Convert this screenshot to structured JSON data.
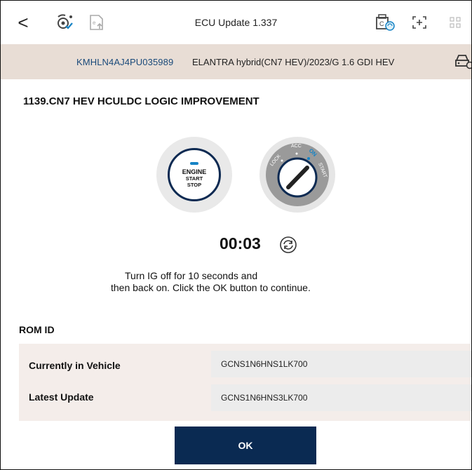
{
  "toolbar": {
    "title": "ECU Update 1.337",
    "back_glyph": "<",
    "icons": [
      "back-icon",
      "wireless-diagnosis-icon",
      "ecu-upload-icon",
      "vci-connection-icon",
      "screen-capture-icon",
      "grid-menu-icon"
    ]
  },
  "vehicle": {
    "vin": "KMHLN4AJ4PU035989",
    "description": "ELANTRA hybrid(CN7 HEV)/2023/G 1.6 GDI HEV"
  },
  "update": {
    "heading": "1139.CN7 HEV HCULDC LOGIC IMPROVEMENT",
    "engine_button": {
      "line1": "ENGINE",
      "line2": "START",
      "line3": "STOP"
    },
    "ignition_positions": [
      "LOCK",
      "ACC",
      "ON",
      "START"
    ],
    "timer": "00:03",
    "instruction_line1": "Turn IG off for 10 seconds and",
    "instruction_line2": "then back on. Click the OK button to continue."
  },
  "rom": {
    "title": "ROM ID",
    "rows": [
      {
        "label": "Currently in Vehicle",
        "value": "GCNS1N6HNS1LK700"
      },
      {
        "label": "Latest Update",
        "value": "GCNS1N6HNS3LK700"
      }
    ]
  },
  "ok_label": "OK",
  "colors": {
    "accent": "#0a2a52",
    "vehicle_bar": "#e8ddd5",
    "vin_text": "#1a4a7a",
    "highlight": "#1683c5"
  }
}
